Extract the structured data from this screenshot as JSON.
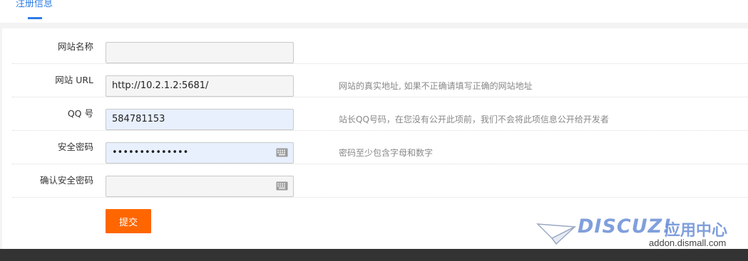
{
  "tabs": [
    {
      "label": "注册信息",
      "active": true
    }
  ],
  "form": {
    "rows": [
      {
        "label": "网站名称",
        "value": "",
        "hint": ""
      },
      {
        "label": "网站 URL",
        "value": "http://10.2.1.2:5681/",
        "hint": "网站的真实地址, 如果不正确请填写正确的网站地址"
      },
      {
        "label": "QQ 号",
        "value": "584781153",
        "hint": "站长QQ号码，在您没有公开此项前，我们不会将此项信息公开给开发者"
      },
      {
        "label": "安全密码",
        "value": "••••••••••••••",
        "hint": "密码至少包含字母和数字"
      },
      {
        "label": "确认安全密码",
        "value": "",
        "hint": ""
      }
    ],
    "submit_label": "提交"
  },
  "watermark": {
    "brand": "DISCUZ!",
    "cn": "应用中心",
    "url": "addon.dismall.com"
  },
  "colors": {
    "accent": "#2d7be5",
    "submit": "#ff6600",
    "autofill": "#e8f0fe"
  }
}
